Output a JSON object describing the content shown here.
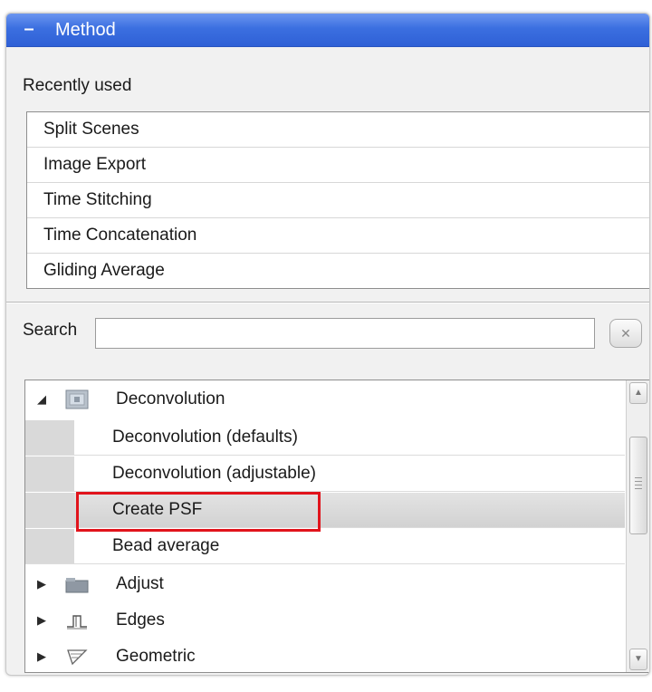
{
  "panel": {
    "title": "Method",
    "collapse_glyph": "–",
    "accent_color": "#3b6fe0"
  },
  "recently_used": {
    "label": "Recently used",
    "items": [
      "Split Scenes",
      "Image Export",
      "Time Stitching",
      "Time Concatenation",
      "Gliding Average"
    ]
  },
  "search": {
    "label": "Search",
    "value": "",
    "placeholder": "",
    "clear_icon": "x-icon",
    "clear_glyph": "✕"
  },
  "tree": {
    "expanded_glyph": "◢",
    "collapsed_glyph": "▶",
    "categories": [
      {
        "label": "Deconvolution",
        "icon": "deconvolution-icon",
        "expanded": true,
        "children": [
          "Deconvolution (defaults)",
          "Deconvolution (adjustable)",
          "Create PSF",
          "Bead average"
        ],
        "selected_child": "Create PSF"
      },
      {
        "label": "Adjust",
        "icon": "adjust-icon",
        "expanded": false
      },
      {
        "label": "Edges",
        "icon": "edges-icon",
        "expanded": false
      },
      {
        "label": "Geometric",
        "icon": "geometric-icon",
        "expanded": false
      }
    ]
  },
  "colors": {
    "highlight_border": "#e1141c",
    "selected_row": "#d6d6d6"
  }
}
